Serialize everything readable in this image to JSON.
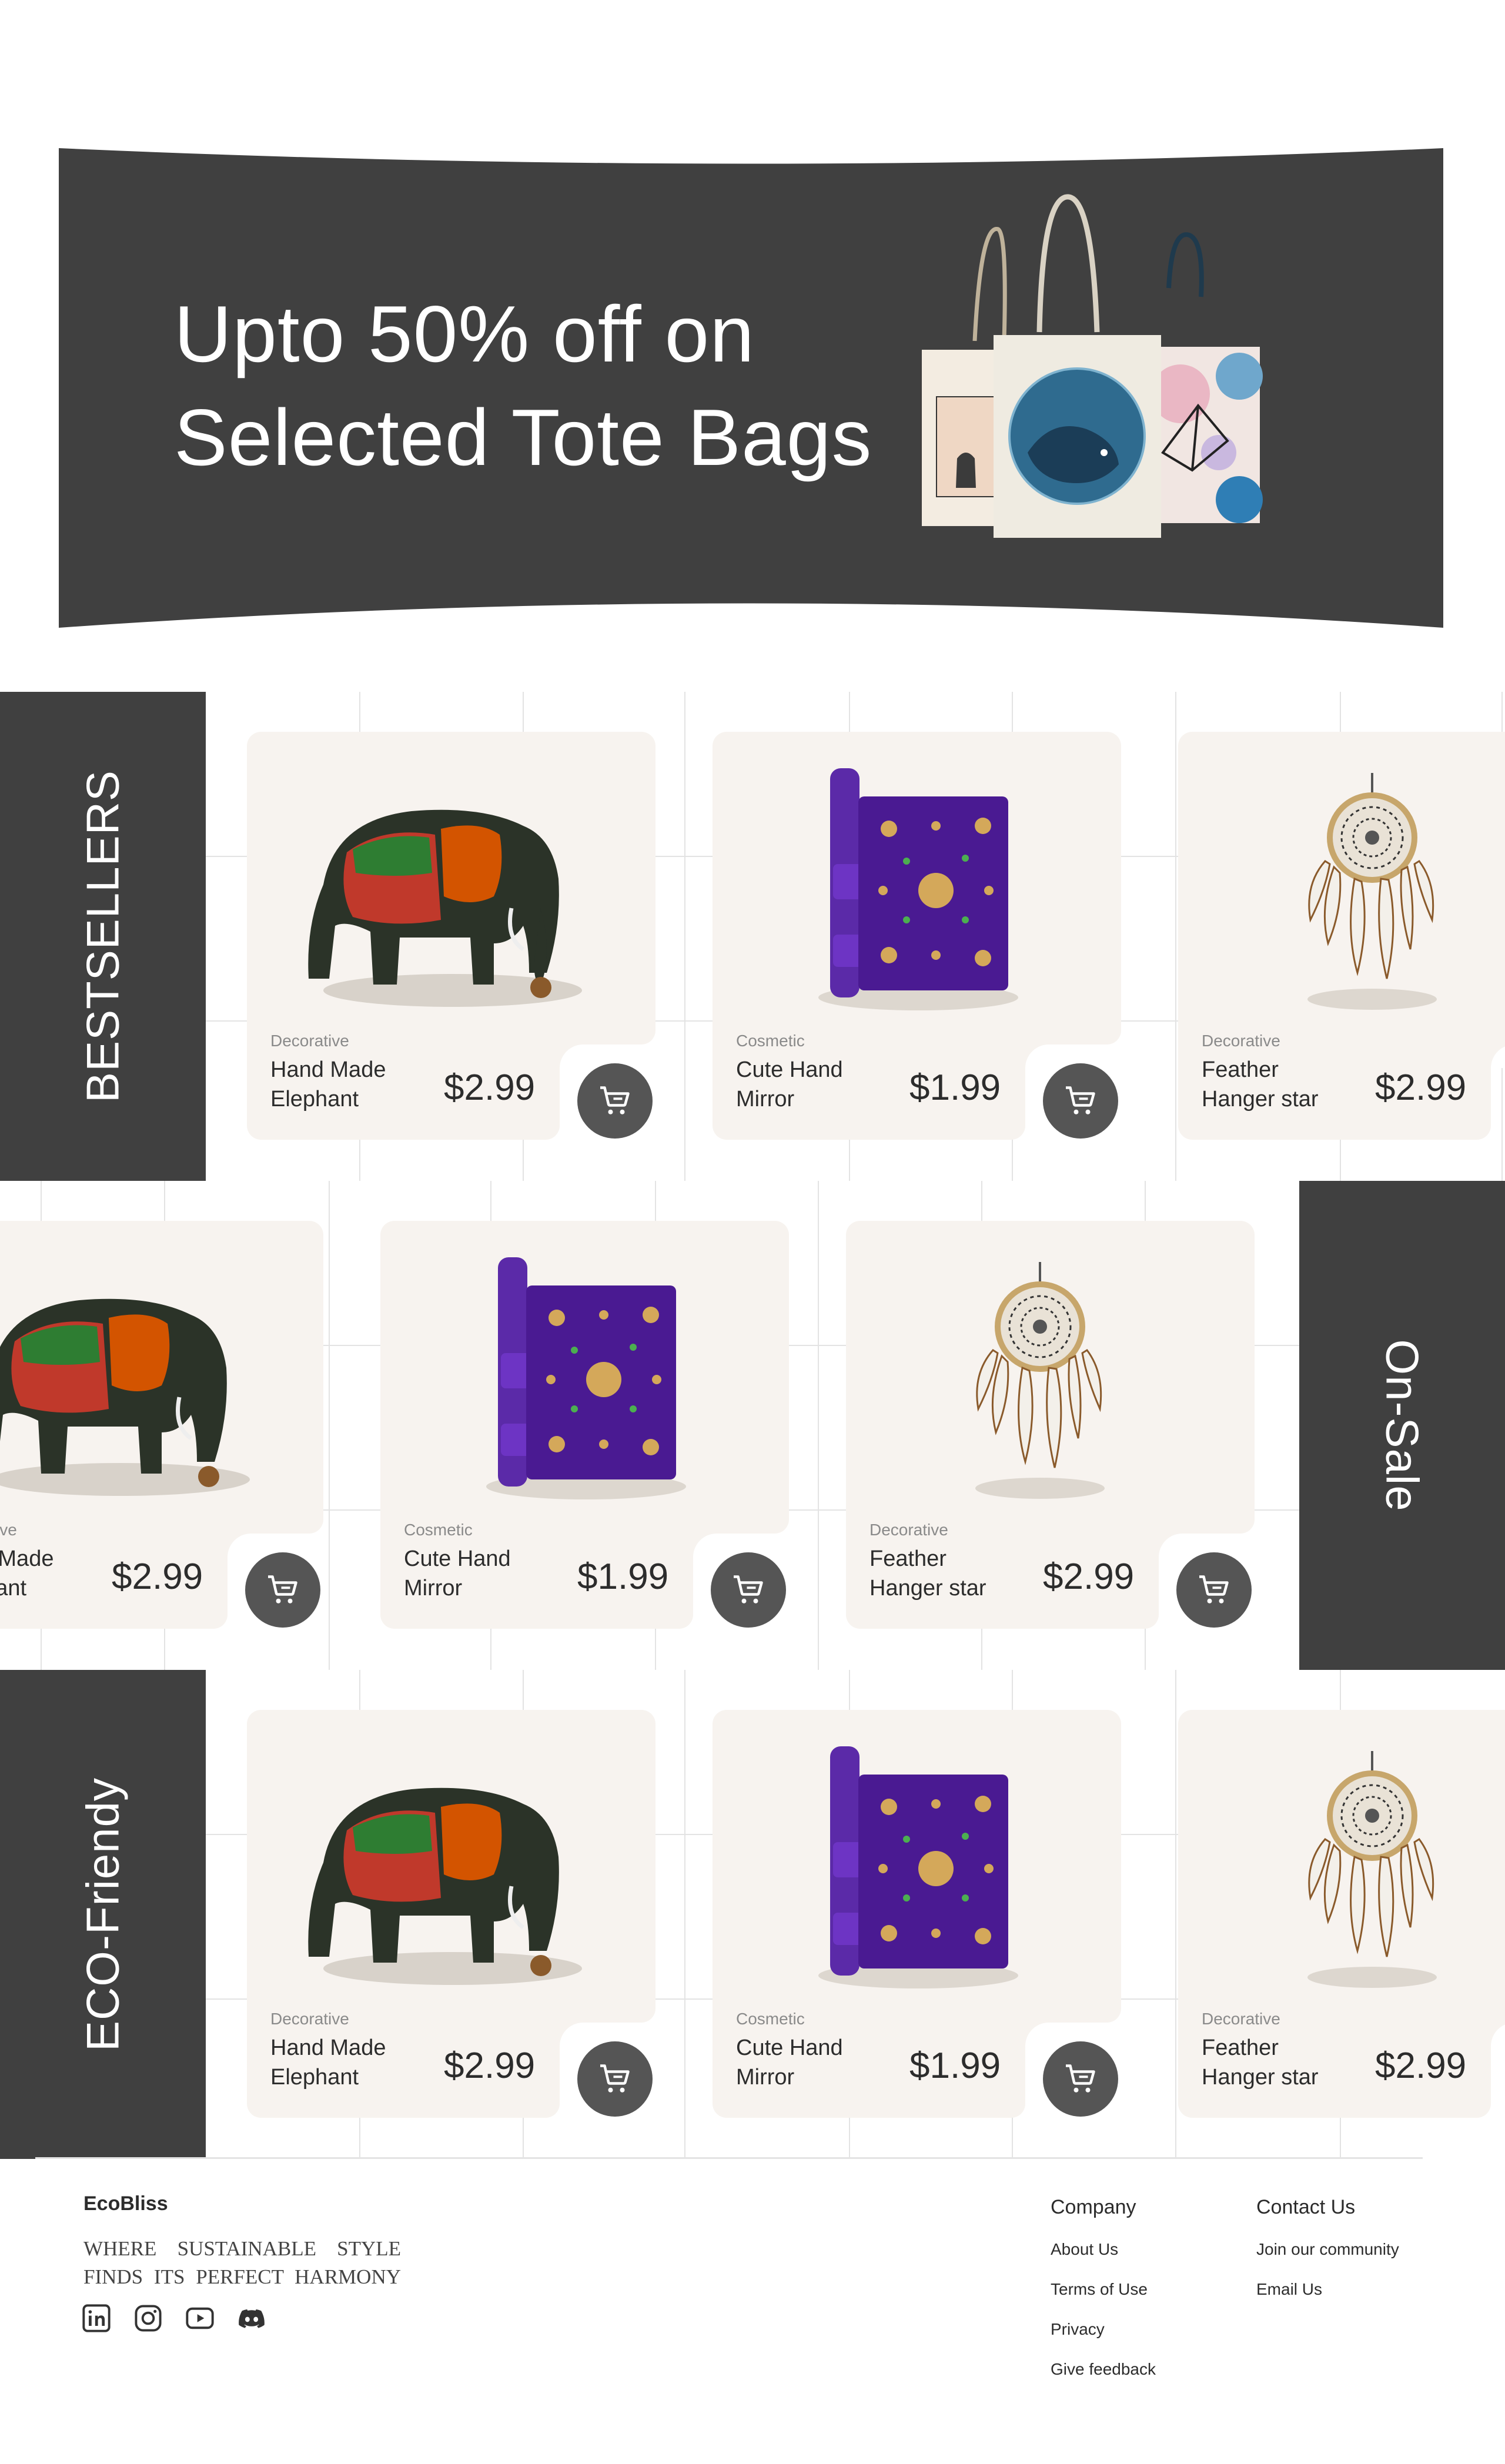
{
  "hero": {
    "line1": "Upto 50% off on",
    "line2": "Selected Tote Bags",
    "bg_color": "#404040"
  },
  "sections": [
    {
      "label": "BESTSELLERS",
      "products": [
        {
          "category": "Decorative",
          "name": "Hand Made Elephant",
          "price": "$2.99",
          "image": "elephant"
        },
        {
          "category": "Cosmetic",
          "name": "Cute Hand Mirror",
          "price": "$1.99",
          "image": "mirror"
        },
        {
          "category": "Decorative",
          "name": "Feather Hanger star",
          "price": "$2.99",
          "image": "dreamcatcher"
        }
      ]
    },
    {
      "label": "On-Sale",
      "products": [
        {
          "category": "Decorative",
          "name": "Hand Made Elephant",
          "price": "$2.99",
          "image": "elephant"
        },
        {
          "category": "Cosmetic",
          "name": "Cute Hand Mirror",
          "price": "$1.99",
          "image": "mirror"
        },
        {
          "category": "Decorative",
          "name": "Feather Hanger star",
          "price": "$2.99",
          "image": "dreamcatcher"
        }
      ]
    },
    {
      "label": "ECO-Friendy",
      "products": [
        {
          "category": "Decorative",
          "name": "Hand Made Elephant",
          "price": "$2.99",
          "image": "elephant"
        },
        {
          "category": "Cosmetic",
          "name": "Cute Hand Mirror",
          "price": "$1.99",
          "image": "mirror"
        },
        {
          "category": "Decorative",
          "name": "Feather Hanger star",
          "price": "$2.99",
          "image": "dreamcatcher"
        }
      ]
    }
  ],
  "footer": {
    "brand": "EcoBliss",
    "tagline": "Where sustainable style finds its perfect harmony",
    "socials": [
      "linkedin-icon",
      "instagram-icon",
      "youtube-icon",
      "discord-icon"
    ],
    "company": {
      "title": "Company",
      "links": [
        "About Us",
        "Terms of Use",
        "Privacy",
        "Give feedback"
      ]
    },
    "contact": {
      "title": "Contact Us",
      "links": [
        "Join our community",
        "Email Us"
      ]
    }
  },
  "colors": {
    "dark": "#404040",
    "card_bg": "#f7f3ef",
    "cart_button": "#555555"
  }
}
